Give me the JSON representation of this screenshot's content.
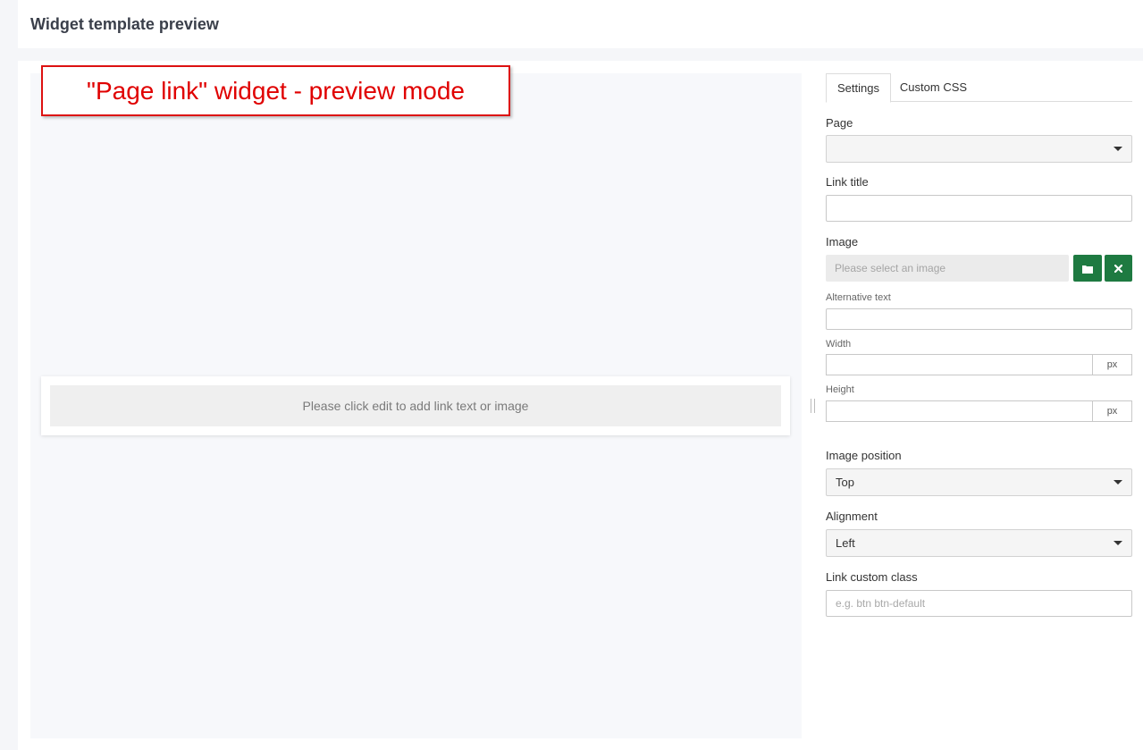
{
  "header": {
    "title": "Widget template preview"
  },
  "annotation": {
    "text": "\"Page link\" widget - preview mode"
  },
  "widget": {
    "placeholder_text": "Please click edit to add link text or image"
  },
  "tabs": [
    {
      "label": "Settings",
      "active": true
    },
    {
      "label": "Custom CSS",
      "active": false
    }
  ],
  "form": {
    "page_label": "Page",
    "page_value": "",
    "link_title_label": "Link title",
    "link_title_value": "",
    "image_label": "Image",
    "image_placeholder": "Please select an image",
    "alt_text_label": "Alternative text",
    "width_label": "Width",
    "width_unit": "px",
    "height_label": "Height",
    "height_unit": "px",
    "image_position_label": "Image position",
    "image_position_value": "Top",
    "alignment_label": "Alignment",
    "alignment_value": "Left",
    "custom_class_label": "Link custom class",
    "custom_class_placeholder": "e.g. btn btn-default"
  },
  "colors": {
    "accent_green": "#1e7a41",
    "annotation_red": "#e00000"
  }
}
